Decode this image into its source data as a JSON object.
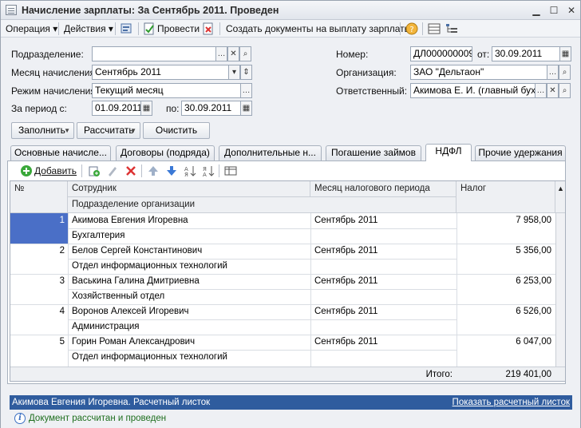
{
  "window": {
    "title": "Начисление зарплаты: За Сентябрь 2011. Проведен"
  },
  "toolbar": {
    "operation": "Операция",
    "actions": "Действия",
    "post": "Провести",
    "create_docs": "Создать документы на выплату зарплаты"
  },
  "form": {
    "division_label": "Подразделение:",
    "division_value": "",
    "month_label": "Месяц начисления:",
    "month_value": "Сентябрь 2011",
    "mode_label": "Режим начисления:",
    "mode_value": "Текущий месяц",
    "period_label": "За период с:",
    "period_from": "01.09.2011",
    "period_to_label": "по:",
    "period_to": "30.09.2011",
    "number_label": "Номер:",
    "number_value": "ДЛ000000009",
    "date_label": "от:",
    "date_value": "30.09.2011",
    "org_label": "Организация:",
    "org_value": "ЗАО \"Дельтаон\"",
    "resp_label": "Ответственный:",
    "resp_value": "Акимова Е. И. (главный бухга"
  },
  "buttons": {
    "fill": "Заполнить",
    "calc": "Рассчитать",
    "clear": "Очистить"
  },
  "tabs": [
    "Основные начисле...",
    "Договоры (подряда)",
    "Дополнительные н...",
    "Погашение займов",
    "НДФЛ",
    "Прочие удержания"
  ],
  "table": {
    "add": "Добавить",
    "headers": {
      "num": "№",
      "employee": "Сотрудник",
      "division": "Подразделение организации",
      "month": "Месяц налогового периода",
      "tax": "Налог"
    },
    "rows": [
      {
        "n": "1",
        "employee": "Акимова Евгения Игоревна",
        "division": "Бухгалтерия",
        "month": "Сентябрь 2011",
        "tax": "7 958,00"
      },
      {
        "n": "2",
        "employee": "Белов Сергей Константинович",
        "division": "Отдел информационных технологий",
        "month": "Сентябрь 2011",
        "tax": "5 356,00"
      },
      {
        "n": "3",
        "employee": "Васькина Галина Дмитриевна",
        "division": "Хозяйственный отдел",
        "month": "Сентябрь 2011",
        "tax": "6 253,00"
      },
      {
        "n": "4",
        "employee": "Воронов Алексей Игоревич",
        "division": "Администрация",
        "month": "Сентябрь 2011",
        "tax": "6 526,00"
      },
      {
        "n": "5",
        "employee": "Горин Роман Александрович",
        "division": "Отдел информационных технологий",
        "month": "Сентябрь 2011",
        "tax": "6 047,00"
      }
    ],
    "total_label": "Итого:",
    "total_value": "219 401,00"
  },
  "status": {
    "employee": "Акимова Евгения Игоревна. Расчетный листок",
    "link": "Показать расчетный листок"
  },
  "footer": {
    "message": "Документ рассчитан и проведен"
  },
  "colors": {
    "selection": "#4a6fc7",
    "status_bar": "#2f5c9e"
  }
}
